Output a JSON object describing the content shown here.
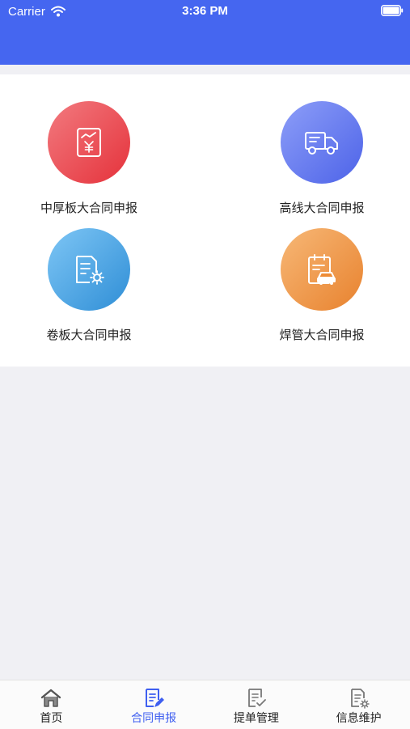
{
  "status_bar": {
    "carrier": "Carrier",
    "time": "3:36 PM",
    "header_color": "#4566f0"
  },
  "grid": {
    "items": [
      {
        "label": "中厚板大合同申报",
        "icon": "receipt-yuan-icon",
        "color": "#e84046"
      },
      {
        "label": "高线大合同申报",
        "icon": "delivery-truck-icon",
        "color": "#5a6ff0"
      },
      {
        "label": "卷板大合同申报",
        "icon": "document-gear-icon",
        "color": "#3d9be0"
      },
      {
        "label": "焊管大合同申报",
        "icon": "clipboard-car-icon",
        "color": "#ee8c36"
      }
    ]
  },
  "tab_bar": {
    "active_color": "#3f5ff0",
    "tabs": [
      {
        "label": "首页",
        "icon": "home-icon",
        "active": false
      },
      {
        "label": "合同申报",
        "icon": "contract-report-icon",
        "active": true
      },
      {
        "label": "提单管理",
        "icon": "document-check-icon",
        "active": false
      },
      {
        "label": "信息维护",
        "icon": "document-settings-icon",
        "active": false
      }
    ]
  }
}
